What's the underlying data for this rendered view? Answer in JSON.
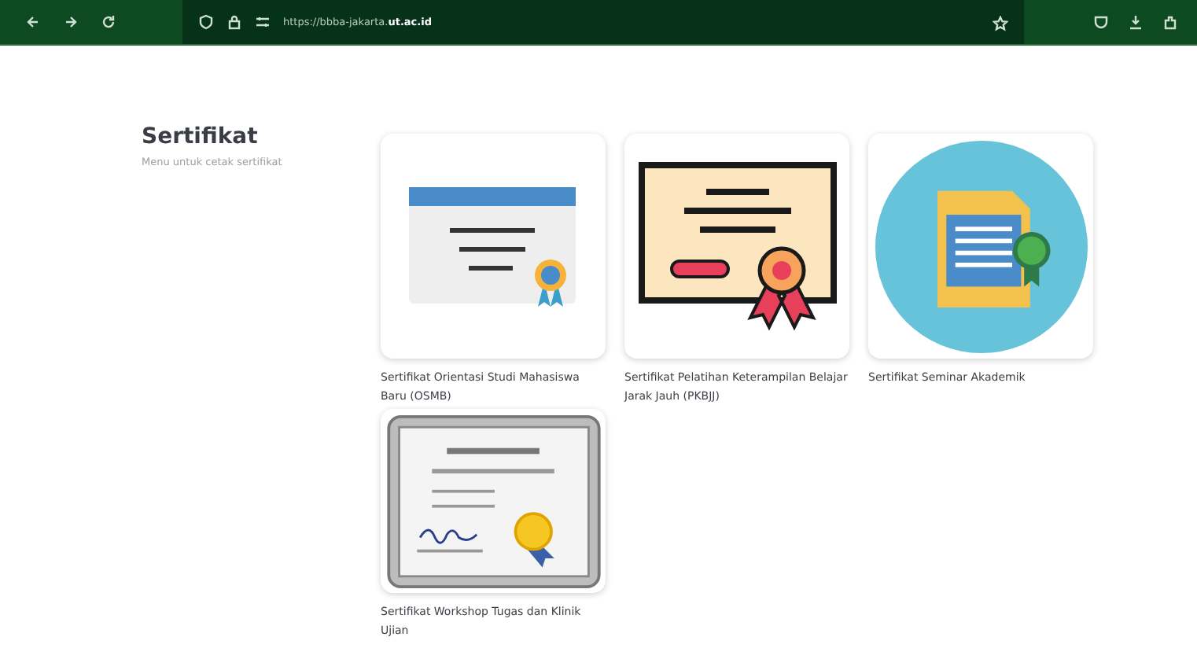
{
  "browser": {
    "url_path": "https://bbba-jakarta.",
    "url_host": "ut.ac.id"
  },
  "header": {
    "title": "Sertifikat",
    "subtitle": "Menu untuk cetak sertifikat"
  },
  "cards": [
    {
      "title": "Sertifikat Orientasi Studi Mahasiswa Baru (OSMB)",
      "kind": "window"
    },
    {
      "title": "Sertifikat Pelatihan Keterampilan Belajar Jarak Jauh (PKBJJ)",
      "kind": "award"
    },
    {
      "title": "Sertifikat Seminar Akademik",
      "kind": "document"
    },
    {
      "title": "Sertifikat Workshop Tugas dan Klinik Ujian",
      "kind": "diploma"
    }
  ]
}
